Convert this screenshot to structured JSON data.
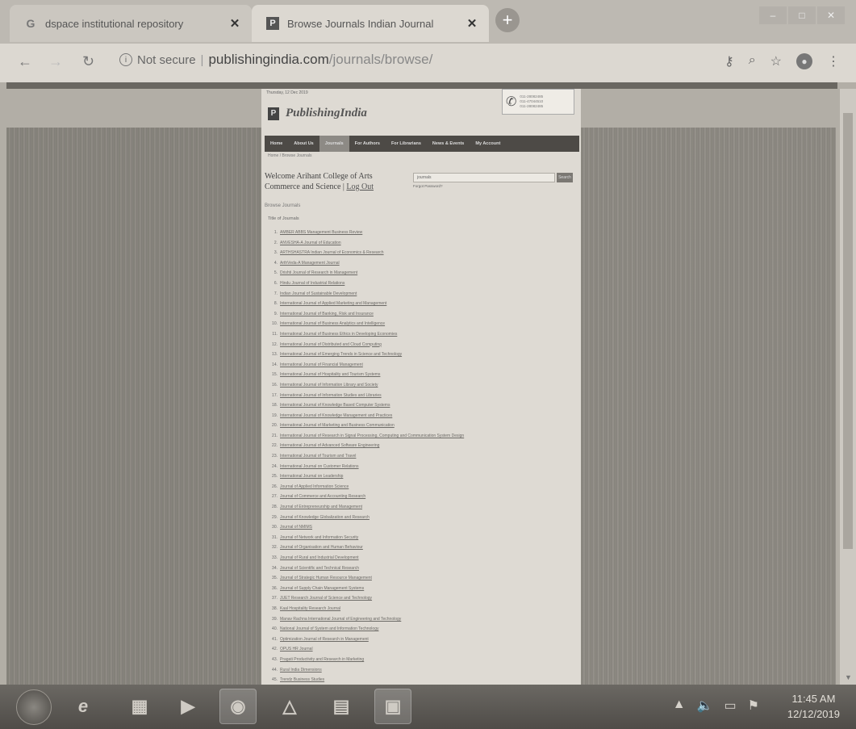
{
  "browser": {
    "tabs": [
      {
        "title": "dspace institutional repository",
        "favicon": "google-g-icon"
      },
      {
        "title": "Browse Journals Indian Journal",
        "favicon": "publishingindia-favicon"
      }
    ],
    "address": {
      "security": "Not secure",
      "host": "publishingindia.com",
      "path": "/journals/browse/"
    }
  },
  "site": {
    "date_line": "Thursday, 12 Dec 2019",
    "logo_text": "PublishingIndia",
    "phones": [
      "011-28082485",
      "011-47044510",
      "011-28082485"
    ],
    "menu": [
      "Home",
      "About Us",
      "Journals",
      "For Authors",
      "For Librarians",
      "News & Events",
      "My Account"
    ],
    "active_menu": "Journals",
    "breadcrumb": "Home / Browse Journals",
    "welcome_text": "Welcome Arihant College of Arts Commerce and Science |",
    "logout_label": "Log Out",
    "search_value": "journals",
    "search_button": "Search",
    "search_hint": "Forgot Password?",
    "browse_heading": "Browse Journals",
    "list_heading": "Title of Journals",
    "journals": [
      "AMBER ABBS Management Business Review",
      "ANVESHA-A Journal of Education",
      "ARTHSHASTRA Indian Journal of Economics & Research",
      "ArthVeda-A Management Journal",
      "Drishti Journal of Research in Management",
      "Hindu Journal of Industrial Relations",
      "Indian Journal of Sustainable Development",
      "International Journal of Applied Marketing and Management",
      "International Journal of Banking, Risk and Insurance",
      "International Journal of Business Analytics and Intelligence",
      "International Journal of Business Ethics in Developing Economies",
      "International Journal of Distributed and Cloud Computing",
      "International Journal of Emerging Trends in Science and Technology",
      "International Journal of Financial Management",
      "International Journal of Hospitality and Tourism Systems",
      "International Journal of Information Library and Society",
      "International Journal of Information Studies and Libraries",
      "International Journal of Knowledge Based Computer Systems",
      "International Journal of Knowledge Management and Practices",
      "International Journal of Marketing and Business Communication",
      "International Journal of Research in Signal Processing, Computing and Communication System Design",
      "International Journal of Advanced Software Engineering",
      "International Journal of Tourism and Travel",
      "International Journal on Customer Relations",
      "International Journal on Leadership",
      "Journal of Applied Information Science",
      "Journal of Commerce and Accounting Research",
      "Journal of Entrepreneurship and Management",
      "Journal of Knowledge Globalization and Research",
      "Journal of NMIMS",
      "Journal of Network and Information Security",
      "Journal of Organisation and Human Behaviour",
      "Journal of Rural and Industrial Development",
      "Journal of Scientific and Technical Research",
      "Journal of Strategic Human Resource Management",
      "Journal of Supply Chain Management Systems",
      "JUET Research Journal of Science and Technology",
      "Kaal Hospitality Research Journal",
      "Manav Rachna International Journal of Engineering and Technology",
      "National Journal of System and Information Technology",
      "Optimization Journal of Research in Management",
      "OPUS HR Journal",
      "Pragati Productivity and Research in Marketing",
      "Rural India Dimensions",
      "Trendz Business Studies"
    ]
  },
  "taskbar": {
    "icons": [
      "windows-start-icon",
      "internet-explorer-icon",
      "file-explorer-icon",
      "media-player-icon",
      "chrome-icon",
      "sic-app-icon",
      "excel-icon",
      "image-viewer-icon"
    ],
    "time": "11:45 AM",
    "date": "12/12/2019"
  }
}
